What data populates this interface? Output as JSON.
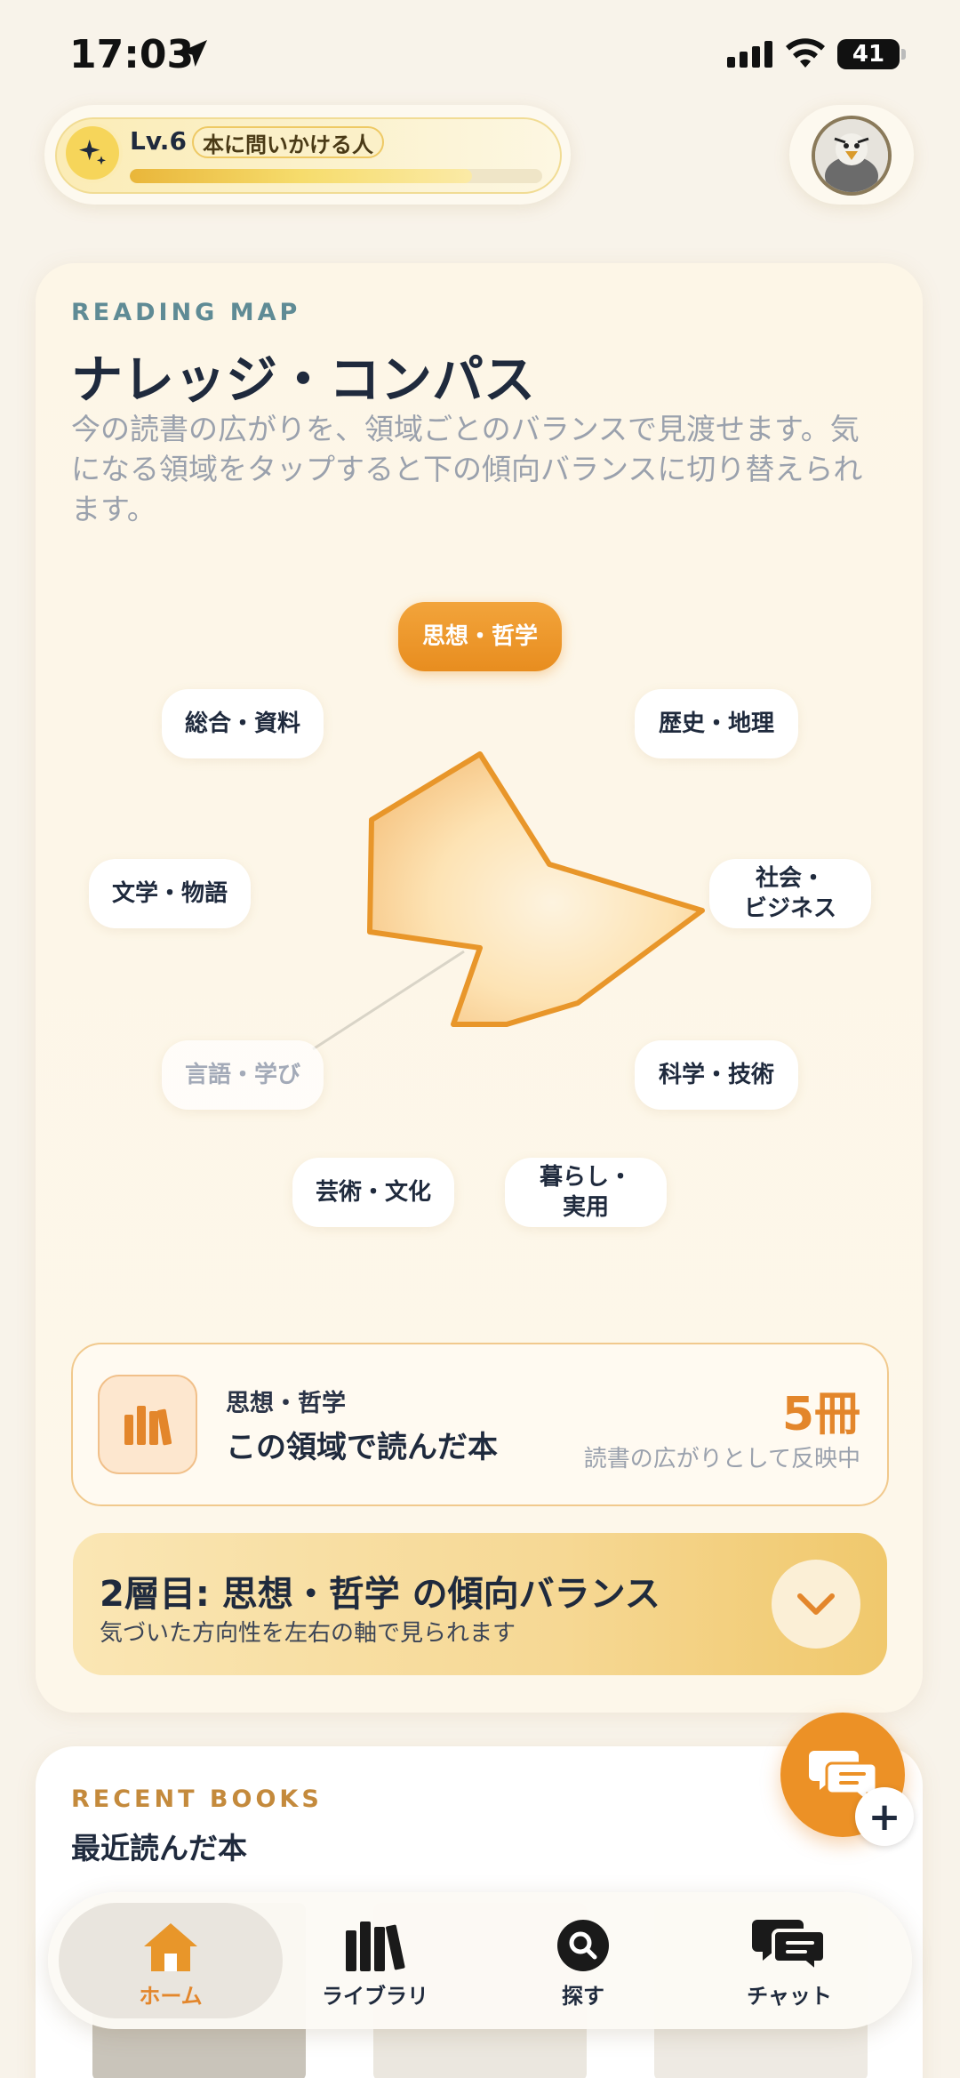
{
  "status": {
    "time": "17:03",
    "battery": "41"
  },
  "level": {
    "label": "Lv.6",
    "title": "本に問いかける人",
    "progress": 0.83
  },
  "map": {
    "eyebrow": "READING MAP",
    "title": "ナレッジ・コンパス",
    "description": "今の読書の広がりを、領域ごとのバランスで見渡せます。気になる領域をタップすると下の傾向バランスに切り替えられます。",
    "categories": [
      {
        "label": "思想・哲学",
        "state": "active"
      },
      {
        "label": "歴史・地理",
        "state": "normal"
      },
      {
        "label": "社会・\nビジネス",
        "state": "normal"
      },
      {
        "label": "科学・技術",
        "state": "normal"
      },
      {
        "label": "暮らし・\n実用",
        "state": "normal"
      },
      {
        "label": "芸術・文化",
        "state": "normal"
      },
      {
        "label": "言語・学び",
        "state": "dim"
      },
      {
        "label": "文学・物語",
        "state": "normal"
      },
      {
        "label": "総合・資料",
        "state": "normal"
      }
    ],
    "accent_color": "#e8962a"
  },
  "count": {
    "category": "思想・哲学",
    "title": "この領域で読んだ本",
    "number": "5冊",
    "note": "読書の広がりとして反映中"
  },
  "layer": {
    "title": "2層目: 思想・哲学 の傾向バランス",
    "subtitle": "気づいた方向性を左右の軸で見られます"
  },
  "recent": {
    "eyebrow": "RECENT BOOKS",
    "title": "最近読んだ本"
  },
  "tabs": [
    {
      "label": "ホーム",
      "icon": "home-icon",
      "active": true
    },
    {
      "label": "ライブラリ",
      "icon": "library-icon",
      "active": false
    },
    {
      "label": "探す",
      "icon": "search-icon",
      "active": false
    },
    {
      "label": "チャット",
      "icon": "chat-icon",
      "active": false
    }
  ]
}
